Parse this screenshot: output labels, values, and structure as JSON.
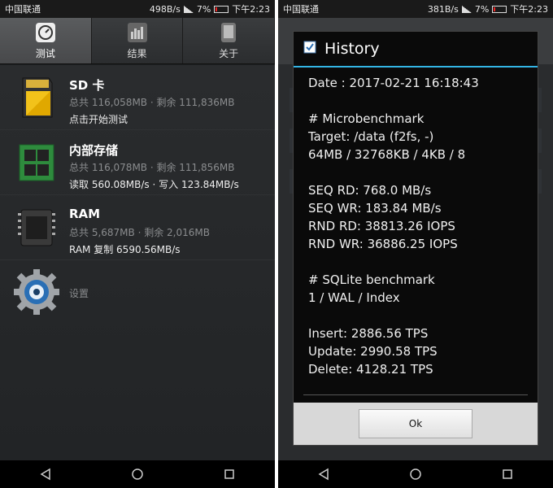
{
  "left": {
    "status": {
      "carrier": "中国联通",
      "speed": "498B/s",
      "battery": "7%",
      "time": "下午2:23"
    },
    "tabs": [
      {
        "label": "测试",
        "icon": "gauge-icon",
        "active": true
      },
      {
        "label": "结果",
        "icon": "bar-chart-icon",
        "active": false
      },
      {
        "label": "关于",
        "icon": "phone-icon",
        "active": false
      }
    ],
    "items": [
      {
        "name": "SD 卡",
        "total": "总共 116,058MB · 剩余 111,836MB",
        "detail": "点击开始测试",
        "icon": "sd-card-icon"
      },
      {
        "name": "内部存储",
        "total": "总共 116,078MB · 剩余 111,856MB",
        "detail": "读取 560.08MB/s · 写入 123.84MB/s",
        "icon": "memory-chip-icon"
      },
      {
        "name": "RAM",
        "total": "总共 5,687MB · 剩余 2,016MB",
        "detail": "RAM 复制 6590.56MB/s",
        "icon": "ram-chip-icon"
      }
    ],
    "settings": {
      "label": "设置",
      "icon": "gear-icon"
    }
  },
  "right": {
    "status": {
      "carrier": "中国联通",
      "speed": "381B/s",
      "battery": "7%",
      "time": "下午2:23"
    },
    "dialog": {
      "title": "History",
      "date": "Date : 2017-02-21 16:18:43",
      "micro_header": "# Microbenchmark",
      "target": "Target: /data (f2fs, -)",
      "config": "64MB / 32768KB / 4KB / 8",
      "seq_rd": "SEQ RD: 768.0 MB/s",
      "seq_wr": "SEQ WR: 183.84 MB/s",
      "rnd_rd": "RND RD: 38813.26 IOPS",
      "rnd_wr": "RND WR: 36886.25 IOPS",
      "sqlite_header": "# SQLite benchmark",
      "sqlite_mode": "1 / WAL / Index",
      "insert": "Insert: 2886.56 TPS",
      "update": "Update: 2990.58 TPS",
      "delete": "Delete: 4128.21 TPS",
      "ok_label": "Ok"
    }
  },
  "colors": {
    "accent": "#33b5e5",
    "background": "#1c1e20"
  }
}
